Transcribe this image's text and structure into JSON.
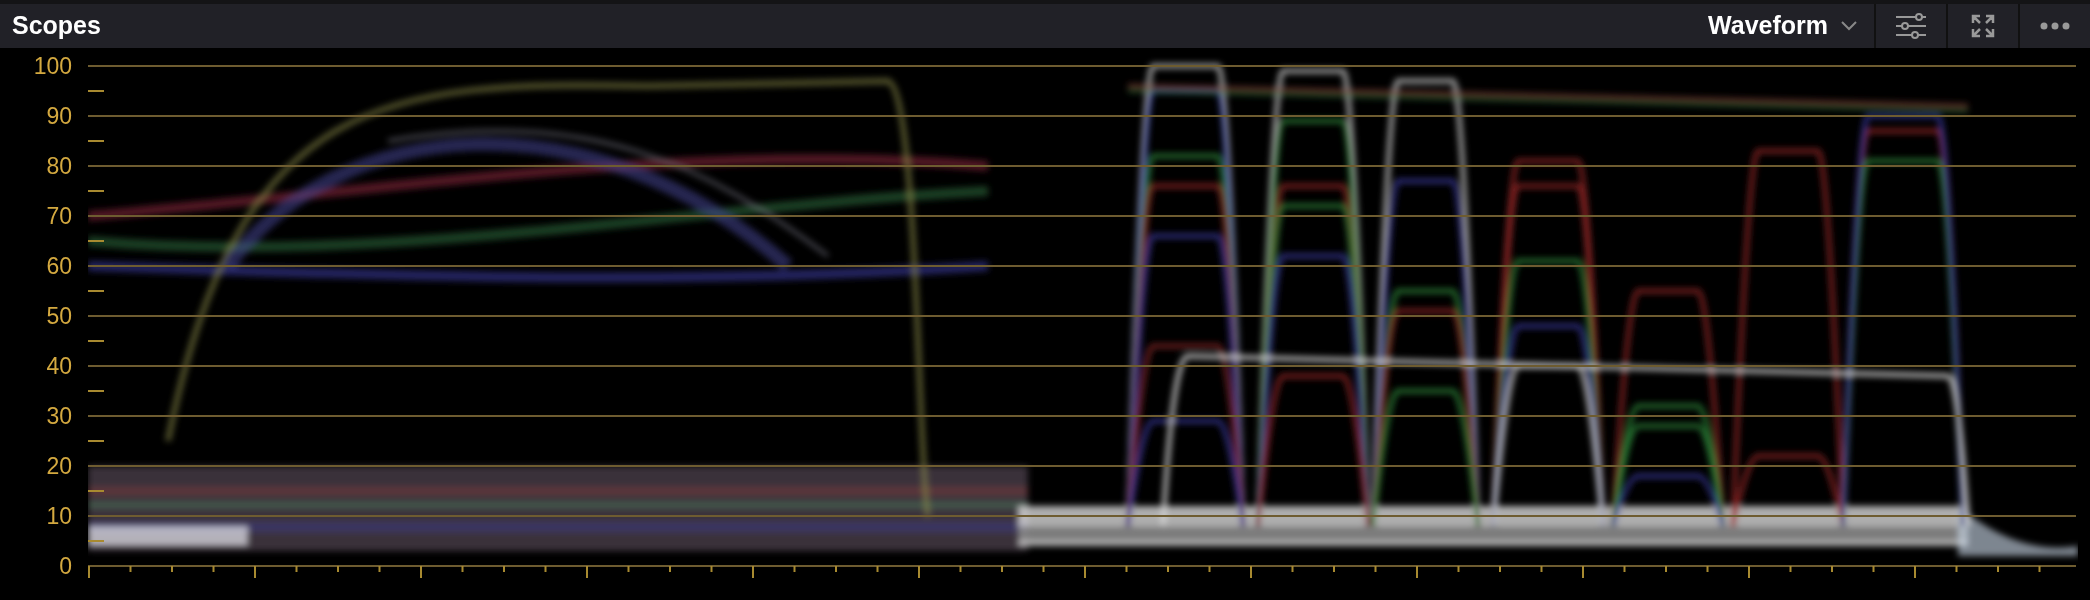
{
  "panel": {
    "title": "Scopes"
  },
  "scope_selector": {
    "value": "Waveform"
  },
  "y_axis_labels": [
    "100",
    "90",
    "80",
    "70",
    "60",
    "50",
    "40",
    "30",
    "20",
    "10",
    "0"
  ]
}
